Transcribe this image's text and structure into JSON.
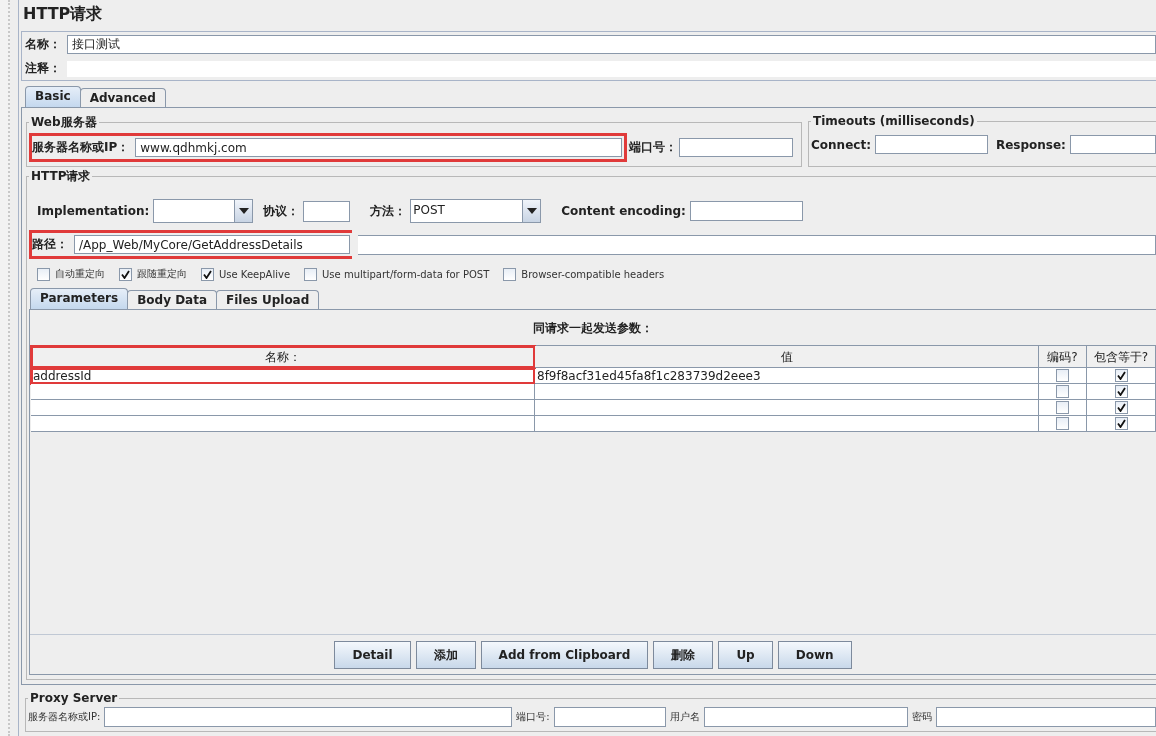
{
  "title": "HTTP请求",
  "name_field": {
    "label": "名称：",
    "value": "接口测试"
  },
  "comment_field": {
    "label": "注释："
  },
  "tabs": [
    {
      "label": "Basic",
      "selected": true
    },
    {
      "label": "Advanced",
      "selected": false
    }
  ],
  "web_server": {
    "legend": "Web服务器",
    "server_label": "服务器名称或IP：",
    "server_value": "www.qdhmkj.com",
    "highlight": true,
    "port_label": "端口号："
  },
  "timeouts": {
    "legend": "Timeouts (milliseconds)",
    "connect_label": "Connect:",
    "response_label": "Response:"
  },
  "http_request": {
    "legend": "HTTP请求",
    "implementation_label": "Implementation:",
    "protocol_label": "协议：",
    "method_label": "方法：",
    "method_value": "POST",
    "encoding_label": "Content encoding:",
    "path_label": "路径：",
    "path_value": "/App_Web/MyCore/GetAddressDetails",
    "path_highlight": true
  },
  "options": [
    {
      "label": "自动重定向",
      "checked": false
    },
    {
      "label": "跟随重定向",
      "checked": true
    },
    {
      "label": "Use KeepAlive",
      "checked": true
    },
    {
      "label": "Use multipart/form-data for POST",
      "checked": false
    },
    {
      "label": "Browser-compatible headers",
      "checked": false
    }
  ],
  "sub_tabs": [
    {
      "label": "Parameters",
      "selected": true
    },
    {
      "label": "Body Data",
      "selected": false
    },
    {
      "label": "Files Upload",
      "selected": false
    }
  ],
  "table": {
    "caption": "同请求一起发送参数：",
    "columns": [
      {
        "label": "名称：",
        "highlight": true
      },
      {
        "label": "值",
        "highlight": false
      },
      {
        "label": "编码?",
        "highlight": false
      },
      {
        "label": "包含等于?",
        "highlight": false
      }
    ],
    "rows": [
      {
        "name": "addressId",
        "value": "8f9f8acf31ed45fa8f1c283739d2eee3",
        "encode": false,
        "include_equals": true
      },
      {
        "encode": false,
        "include_equals": true
      },
      {
        "encode": false,
        "include_equals": true
      },
      {
        "encode": false,
        "include_equals": true
      }
    ]
  },
  "buttons": [
    "Detail",
    "添加",
    "Add from Clipboard",
    "删除",
    "Up",
    "Down"
  ],
  "proxy": {
    "legend": "Proxy Server",
    "server_label": "服务器名称或IP:",
    "port_label": "端口号:",
    "user_label": "用户名",
    "password_label": "密码"
  }
}
